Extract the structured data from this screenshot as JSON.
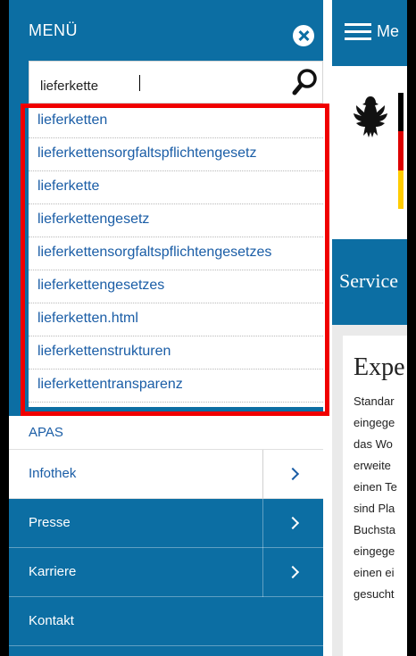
{
  "menu": {
    "title": "MENÜ",
    "close_icon": "close-icon"
  },
  "search": {
    "value": "lieferkette",
    "icon": "search-icon"
  },
  "suggestions": [
    "lieferketten",
    "lieferkettensorgfaltspflichtengesetz",
    "lieferkette",
    "lieferkettengesetz",
    "lieferkettensorgfaltspflichtengesetzes",
    "lieferkettengesetzes",
    "lieferketten.html",
    "lieferkettenstrukturen",
    "lieferkettentransparenz"
  ],
  "menu_items": [
    {
      "label": "APAS",
      "style": "light",
      "has_submenu": false
    },
    {
      "label": "Infothek",
      "style": "light",
      "has_submenu": true
    },
    {
      "label": "Presse",
      "style": "dark",
      "has_submenu": true
    },
    {
      "label": "Karriere",
      "style": "dark",
      "has_submenu": true
    },
    {
      "label": "Kontakt",
      "style": "dark",
      "has_submenu": false
    }
  ],
  "site": {
    "menu_label": "Me",
    "service_label": "Service",
    "heading": "Expe",
    "body_lines": [
      "Standar",
      "eingege",
      "das Wo",
      "erweite",
      "einen Te",
      "sind Pla",
      "Buchsta",
      "eingege",
      "einen ei",
      "gesucht"
    ]
  },
  "colors": {
    "brand_blue": "#0c6ea3",
    "link_blue": "#1a5da6",
    "highlight_red": "#f00000"
  }
}
